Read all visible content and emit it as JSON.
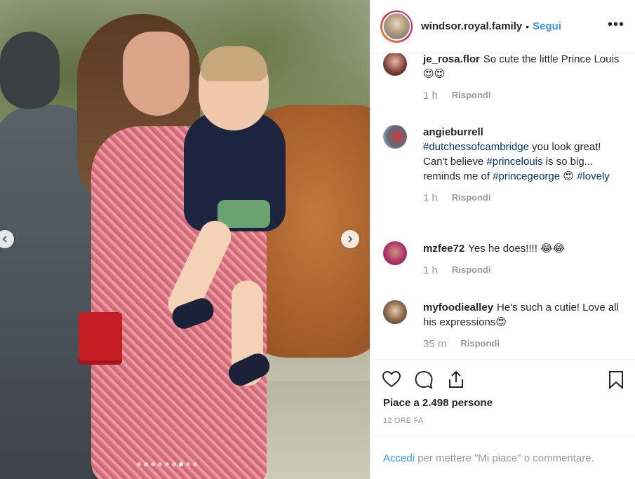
{
  "post": {
    "username": "windsor.royal.family",
    "separator": "•",
    "follow_label": "Segui",
    "more_label": "•••",
    "carousel": {
      "total_slides": 9,
      "active_index": 6
    }
  },
  "comments": [
    {
      "user": "je_rosa.flor",
      "text": "So cute the little Prince Louis😍😍",
      "time": "1 h",
      "reply": "Rispondi"
    },
    {
      "user": "angieburrell",
      "text_parts": [
        {
          "tag": true,
          "text": "#dutchessofcambridge"
        },
        {
          "tag": false,
          "text": " you look great! Can't believe "
        },
        {
          "tag": true,
          "text": "#princelouis"
        },
        {
          "tag": false,
          "text": " is so big... reminds me of "
        },
        {
          "tag": true,
          "text": "#princegeorge"
        },
        {
          "tag": false,
          "text": " 😍 "
        },
        {
          "tag": true,
          "text": "#lovely"
        }
      ],
      "time": "1 h",
      "reply": "Rispondi"
    },
    {
      "user": "mzfee72",
      "text": "Yes he does!!!! 😂😂",
      "time": "1 h",
      "reply": "Rispondi"
    },
    {
      "user": "myfoodiealley",
      "text": "He's such a cutie! Love all his expressions😍",
      "time": "35 m",
      "reply": "Rispondi"
    }
  ],
  "likes_text": "Piace a 2.498 persone",
  "time_ago": "12 ORE FA",
  "login": {
    "link": "Accedi",
    "rest": " per mettere \"Mi piace\" o commentare."
  },
  "colors": {
    "link": "#3897f0",
    "hashtag": "#003569",
    "meta": "#999999"
  },
  "icons": [
    "chevron-left-icon",
    "chevron-right-icon",
    "heart-icon",
    "comment-icon",
    "share-icon",
    "bookmark-icon"
  ]
}
